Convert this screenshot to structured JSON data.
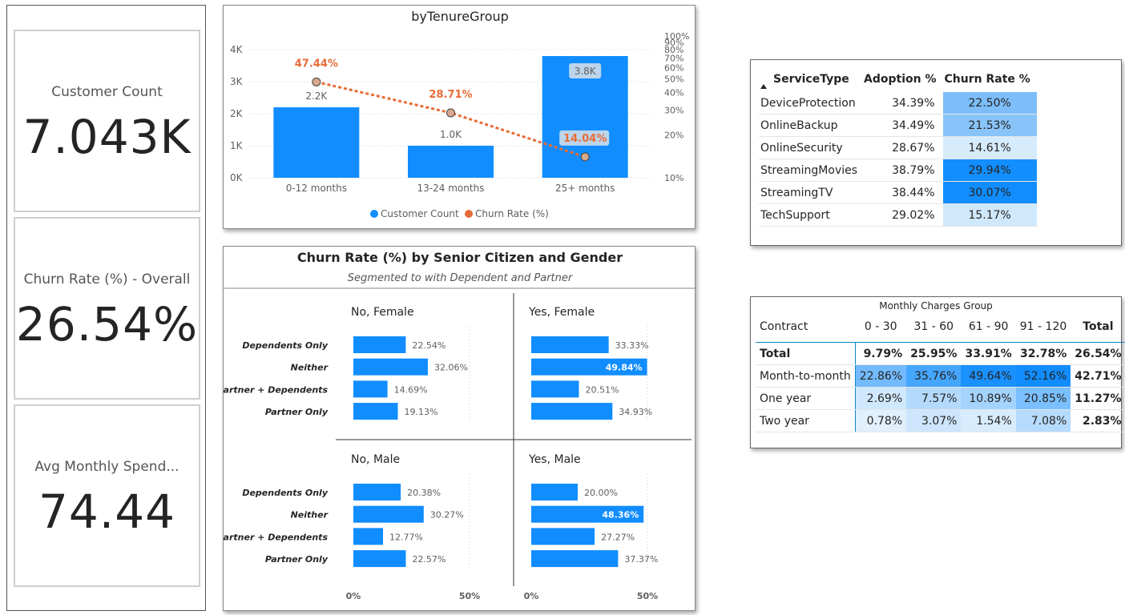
{
  "kpis": [
    {
      "title": "Customer Count",
      "value": "7.043K"
    },
    {
      "title": "Churn Rate (%) - Overall",
      "value": "26.54%"
    },
    {
      "title": "Avg Monthly Spend...",
      "value": "74.44"
    }
  ],
  "colors": {
    "bar": "#118dff",
    "line": "#e66c37",
    "accent_dark": "#0e86c7"
  },
  "chart_data": [
    {
      "type": "bar",
      "title": "byTenureGroup",
      "categories": [
        "0-12 months",
        "13-24 months",
        "25+ months"
      ],
      "series": [
        {
          "name": "Customer Count",
          "type": "bar",
          "values": [
            2200,
            1000,
            3800
          ],
          "labels": [
            "2.2K",
            "1.0K",
            "3.8K"
          ]
        },
        {
          "name": "Churn Rate (%)",
          "type": "line",
          "values": [
            47.44,
            28.71,
            14.04
          ],
          "labels": [
            "47.44%",
            "28.71%",
            "14.04%"
          ]
        }
      ],
      "y_ticks": [
        "0K",
        "1K",
        "2K",
        "3K",
        "4K"
      ],
      "ylim": [
        0,
        4000
      ],
      "y2_ticks": [
        "10%",
        "20%",
        "30%",
        "40%",
        "50%",
        "60%",
        "70%",
        "80%",
        "90%",
        "100%"
      ],
      "y2_scale": "log",
      "y2lim": [
        10,
        100
      ],
      "legend": [
        "Customer Count",
        "Churn Rate (%)"
      ],
      "legend_position": "bottom"
    },
    {
      "type": "bar",
      "title": "Churn Rate (%) by Senior Citizen and Gender",
      "subtitle": "Segmented to with Dependent and Partner",
      "orientation": "horizontal",
      "categories": [
        "Dependents Only",
        "Neither",
        "Partner + Dependents",
        "Partner Only"
      ],
      "xlim": [
        0,
        50
      ],
      "x_ticks": [
        "0%",
        "50%"
      ],
      "panels": [
        {
          "title": "No, Female",
          "values": [
            22.54,
            32.06,
            14.69,
            19.13
          ],
          "labels": [
            "22.54%",
            "32.06%",
            "14.69%",
            "19.13%"
          ]
        },
        {
          "title": "Yes, Female",
          "values": [
            33.33,
            49.84,
            20.51,
            34.93
          ],
          "labels": [
            "33.33%",
            "49.84%",
            "20.51%",
            "34.93%"
          ]
        },
        {
          "title": "No, Male",
          "values": [
            20.38,
            30.27,
            12.77,
            22.57
          ],
          "labels": [
            "20.38%",
            "30.27%",
            "12.77%",
            "22.57%"
          ]
        },
        {
          "title": "Yes, Male",
          "values": [
            20.0,
            48.36,
            27.27,
            37.37
          ],
          "labels": [
            "20.00%",
            "48.36%",
            "27.27%",
            "37.37%"
          ]
        }
      ]
    },
    {
      "type": "table",
      "columns": [
        "ServiceType",
        "Adoption %",
        "Churn Rate %"
      ],
      "rows": [
        [
          "DeviceProtection",
          "34.39%",
          "22.50%"
        ],
        [
          "OnlineBackup",
          "34.49%",
          "21.53%"
        ],
        [
          "OnlineSecurity",
          "28.67%",
          "14.61%"
        ],
        [
          "StreamingMovies",
          "38.79%",
          "29.94%"
        ],
        [
          "StreamingTV",
          "38.44%",
          "30.07%"
        ],
        [
          "TechSupport",
          "29.02%",
          "15.17%"
        ]
      ],
      "churn_values": [
        22.5,
        21.53,
        14.61,
        29.94,
        30.07,
        15.17
      ]
    },
    {
      "type": "table",
      "title": "Monthly Charges Group",
      "columns": [
        "Contract",
        "0 - 30",
        "31 - 60",
        "61 - 90",
        "91 - 120",
        "Total"
      ],
      "rows": [
        [
          "Total",
          "9.79%",
          "25.95%",
          "33.91%",
          "32.78%",
          "26.54%"
        ],
        [
          "Month-to-month",
          "22.86%",
          "35.76%",
          "49.64%",
          "52.16%",
          "42.71%"
        ],
        [
          "One year",
          "2.69%",
          "7.57%",
          "10.89%",
          "20.85%",
          "11.27%"
        ],
        [
          "Two year",
          "0.78%",
          "3.07%",
          "1.54%",
          "7.08%",
          "2.83%"
        ]
      ],
      "cell_values": [
        [
          22.86,
          35.76,
          49.64,
          52.16
        ],
        [
          2.69,
          7.57,
          10.89,
          20.85
        ],
        [
          0.78,
          3.07,
          1.54,
          7.08
        ]
      ]
    }
  ]
}
